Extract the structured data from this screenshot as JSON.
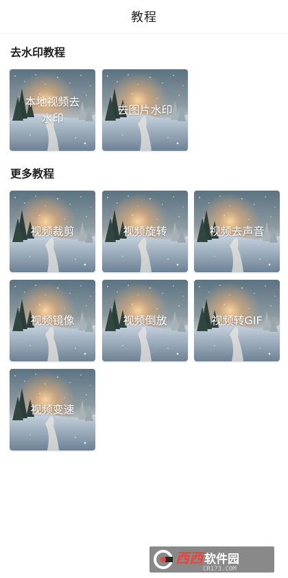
{
  "header": {
    "title": "教程"
  },
  "sections": [
    {
      "title": "去水印教程",
      "tiles": [
        {
          "label": "本地视频去\n水印"
        },
        {
          "label": "去图片水印"
        }
      ]
    },
    {
      "title": "更多教程",
      "tiles": [
        {
          "label": "视频裁剪"
        },
        {
          "label": "视频旋转"
        },
        {
          "label": "视频去声音"
        },
        {
          "label": "视频镜像"
        },
        {
          "label": "视频倒放"
        },
        {
          "label": "视频转GIF"
        },
        {
          "label": "视频变速"
        }
      ]
    }
  ],
  "watermark": {
    "logo_icon": "c-logo-icon",
    "brand_red": "西西",
    "brand_white": "软件园",
    "url": "CR173.COM"
  },
  "colors": {
    "text": "#222222",
    "tile_text": "#ffffff",
    "watermark_red": "#e8453c"
  }
}
